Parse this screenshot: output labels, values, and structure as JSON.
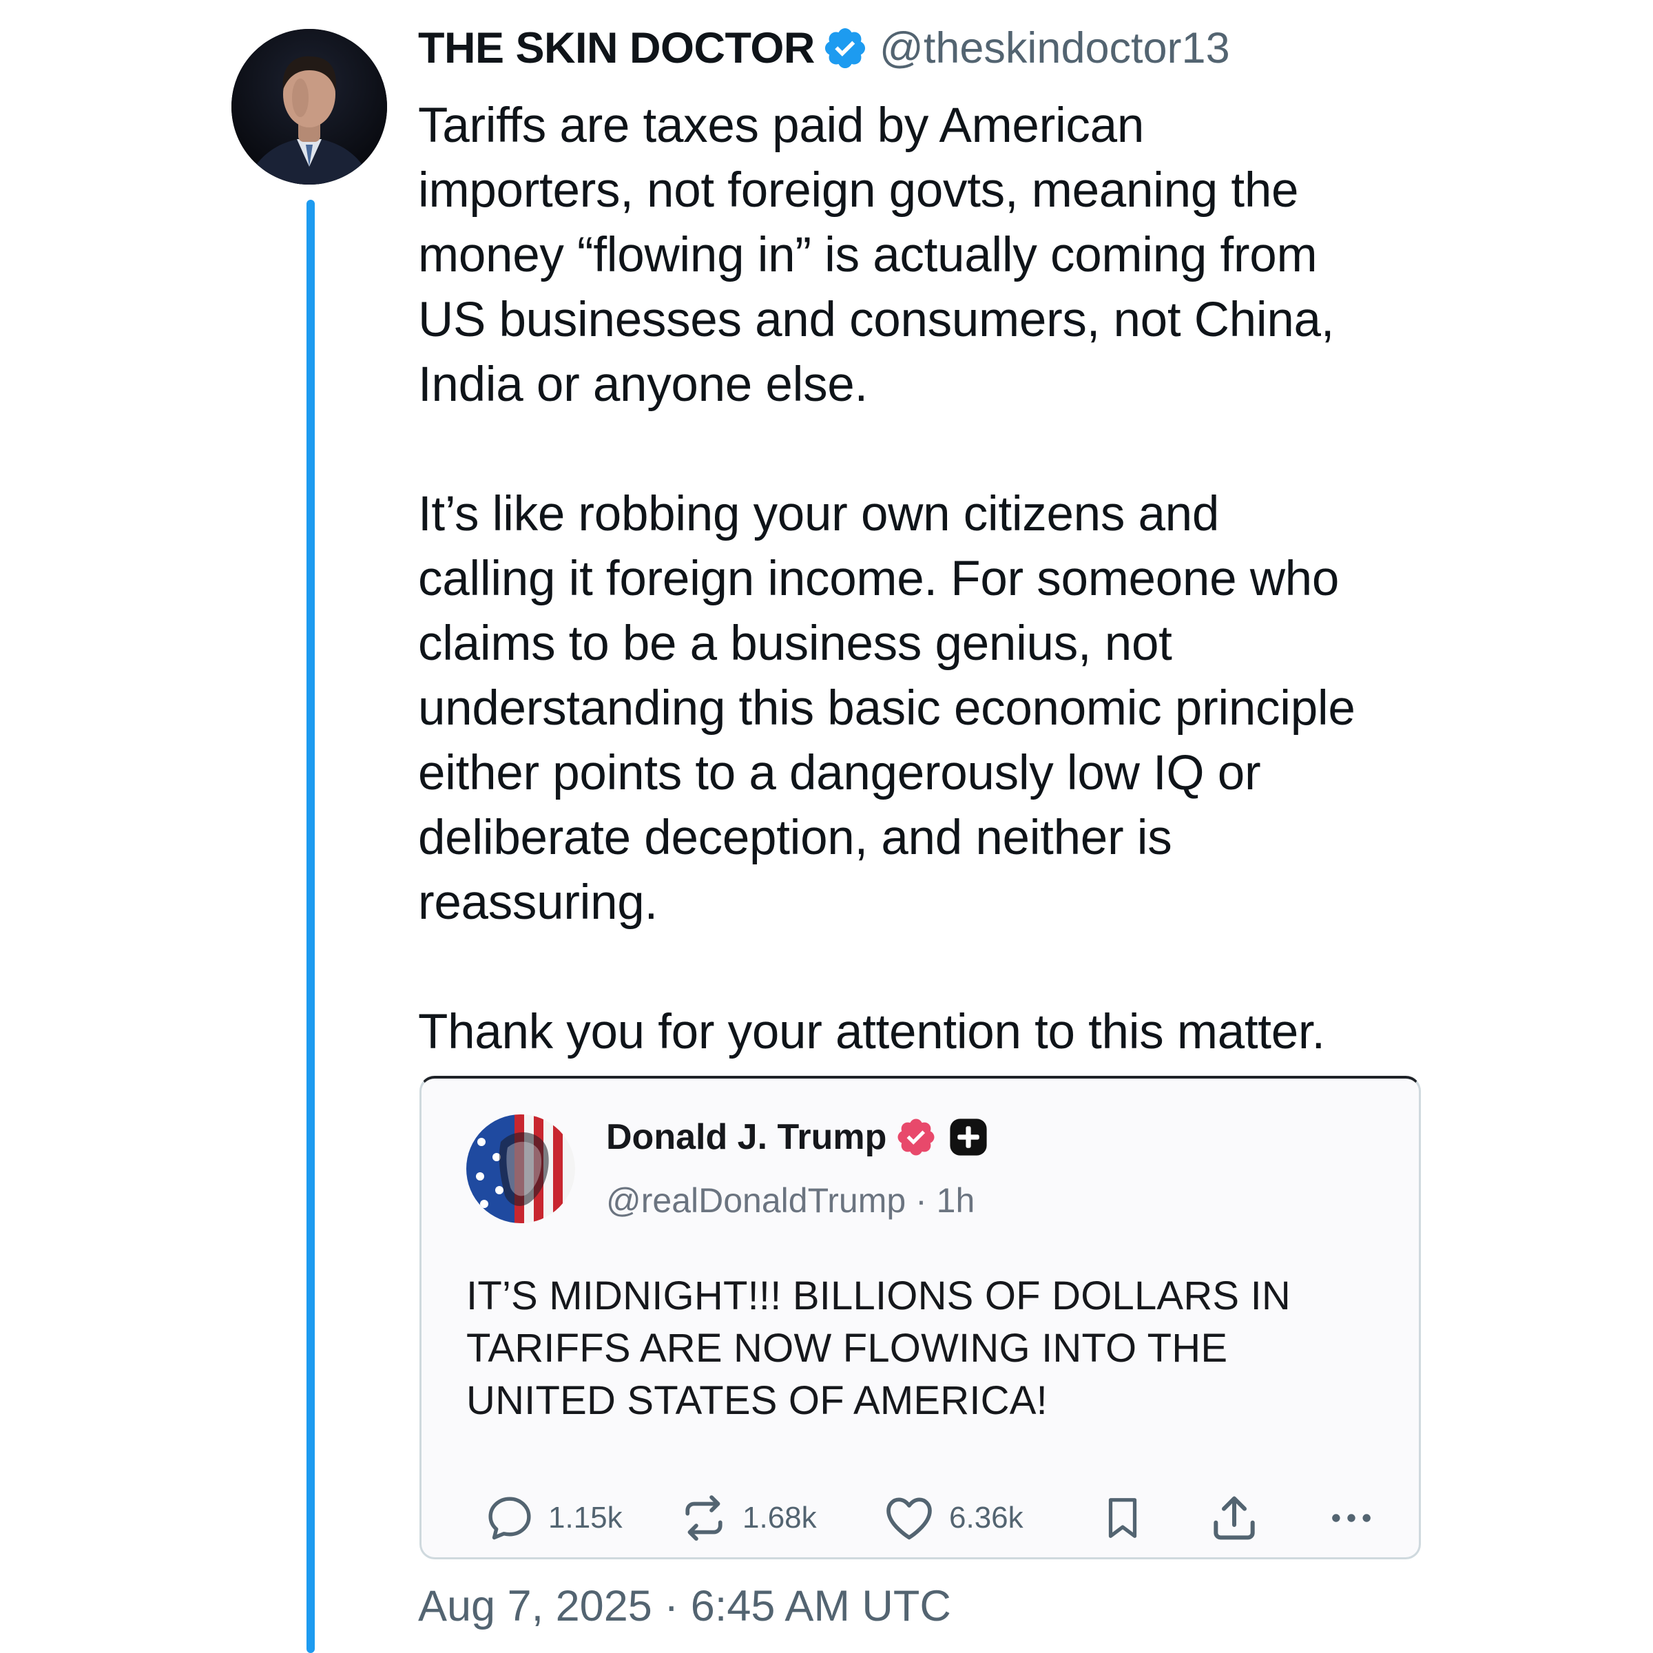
{
  "tweet": {
    "author": {
      "display_name": "THE SKIN DOCTOR",
      "handle": "@theskindoctor13",
      "verified_icon": "verified-badge-icon",
      "verified_color": "#1d9bf0"
    },
    "text": "Tariffs are taxes paid by American\nimporters, not foreign govts, meaning the\nmoney “flowing in” is actually coming from\nUS businesses and consumers, not China,\nIndia or anyone else.\n\nIt’s like robbing your own citizens and\ncalling it foreign income. For someone who\nclaims to be a business genius, not\nunderstanding this basic economic principle\neither points to a dangerously low IQ or\ndeliberate deception, and neither is\nreassuring.\n\nThank you for your attention to this matter.",
    "timestamp": "Aug 7, 2025 · 6:45 AM UTC",
    "thread_line_color": "#1d9bf0"
  },
  "quoted_post": {
    "author": {
      "display_name": "Donald J. Trump",
      "handle": "@realDonaldTrump",
      "time_ago": "· 1h",
      "badge_icon": "verified-badge-icon",
      "badge_color": "#e8496b",
      "extra_icon": "plus-icon"
    },
    "text": "IT’S MIDNIGHT!!! BILLIONS OF DOLLARS IN\nTARIFFS ARE NOW FLOWING INTO THE\nUNITED STATES OF AMERICA!",
    "actions": {
      "replies": {
        "icon": "reply-icon",
        "count": "1.15k"
      },
      "reposts": {
        "icon": "repost-icon",
        "count": "1.68k"
      },
      "likes": {
        "icon": "heart-icon",
        "count": "6.36k"
      },
      "bookmark": {
        "icon": "bookmark-icon"
      },
      "share": {
        "icon": "share-icon"
      },
      "more": {
        "icon": "more-icon"
      }
    }
  }
}
